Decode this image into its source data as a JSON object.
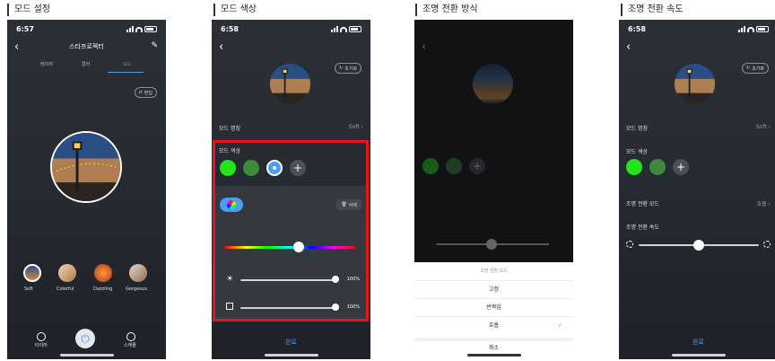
{
  "sections": [
    {
      "title": "모드 설정"
    },
    {
      "title": "모드 색상"
    },
    {
      "title": "조명 전환 방식"
    },
    {
      "title": "조명 전환 속도"
    }
  ],
  "screen1": {
    "time": "6:57",
    "title": "스타프로젝터",
    "tabs": [
      "레이저",
      "컬러",
      "모드"
    ],
    "edit_label": "편집",
    "modes": [
      "Soft",
      "Colorful",
      "Dazzling",
      "Gorgeous"
    ],
    "bottom": {
      "timer": "타이머",
      "schedule": "스케줄"
    }
  },
  "screen2": {
    "time": "6:58",
    "reset_label": "초기화",
    "mode_name_label": "모드 명칭",
    "mode_name_value": "Soft",
    "mode_color_label": "모드 색상",
    "delete_label": "삭제",
    "brightness_value": "100%",
    "saturation_value": "100%",
    "done_label": "완료"
  },
  "screen3": {
    "sheet_title": "조명 전환 모드",
    "options": [
      "고정",
      "번짝임",
      "호흡"
    ],
    "selected_option": "호흡",
    "cancel_label": "취소"
  },
  "screen4": {
    "time": "6:58",
    "reset_label": "초기화",
    "mode_name_label": "모드 명칭",
    "mode_name_value": "Soft",
    "mode_color_label": "모드 색상",
    "transition_mode_label": "조명 전환 모드",
    "transition_mode_value": "호흡",
    "transition_speed_label": "조명 전환 속도",
    "done_label": "완료"
  },
  "colors": {
    "accent": "#4a9df0",
    "green_bright": "#22e61a",
    "green_dark": "#3d8a3d",
    "highlight_red": "#e3141e"
  },
  "slider_levels": {
    "screen2_hue": 0.57,
    "screen2_brightness": 1.0,
    "screen2_saturation": 1.0,
    "screen3_speed": 0.55,
    "screen4_speed": 0.5
  }
}
